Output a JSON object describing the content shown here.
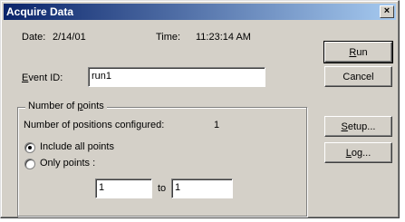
{
  "window": {
    "title": "Acquire Data",
    "close_glyph": "×"
  },
  "info": {
    "date_label": "Date:",
    "date_value": "2/14/01",
    "time_label": "Time:",
    "time_value": "11:23:14 AM"
  },
  "event": {
    "label_prefix": "E",
    "label_rest": "vent ID:",
    "value": "run1"
  },
  "points_group": {
    "label_prefix": "Number of ",
    "label_accel": "p",
    "label_rest": "oints",
    "positions_label": "Number of positions configured:",
    "positions_value": "1",
    "radio_all": "Include all points",
    "radio_only": "Only points :",
    "selected": "all",
    "from_value": "1",
    "to_label": "to",
    "to_value": "1"
  },
  "buttons": {
    "run_accel": "R",
    "run_rest": "un",
    "cancel": "Cancel",
    "setup_accel": "S",
    "setup_rest": "etup...",
    "log_accel": "L",
    "log_rest": "og..."
  }
}
